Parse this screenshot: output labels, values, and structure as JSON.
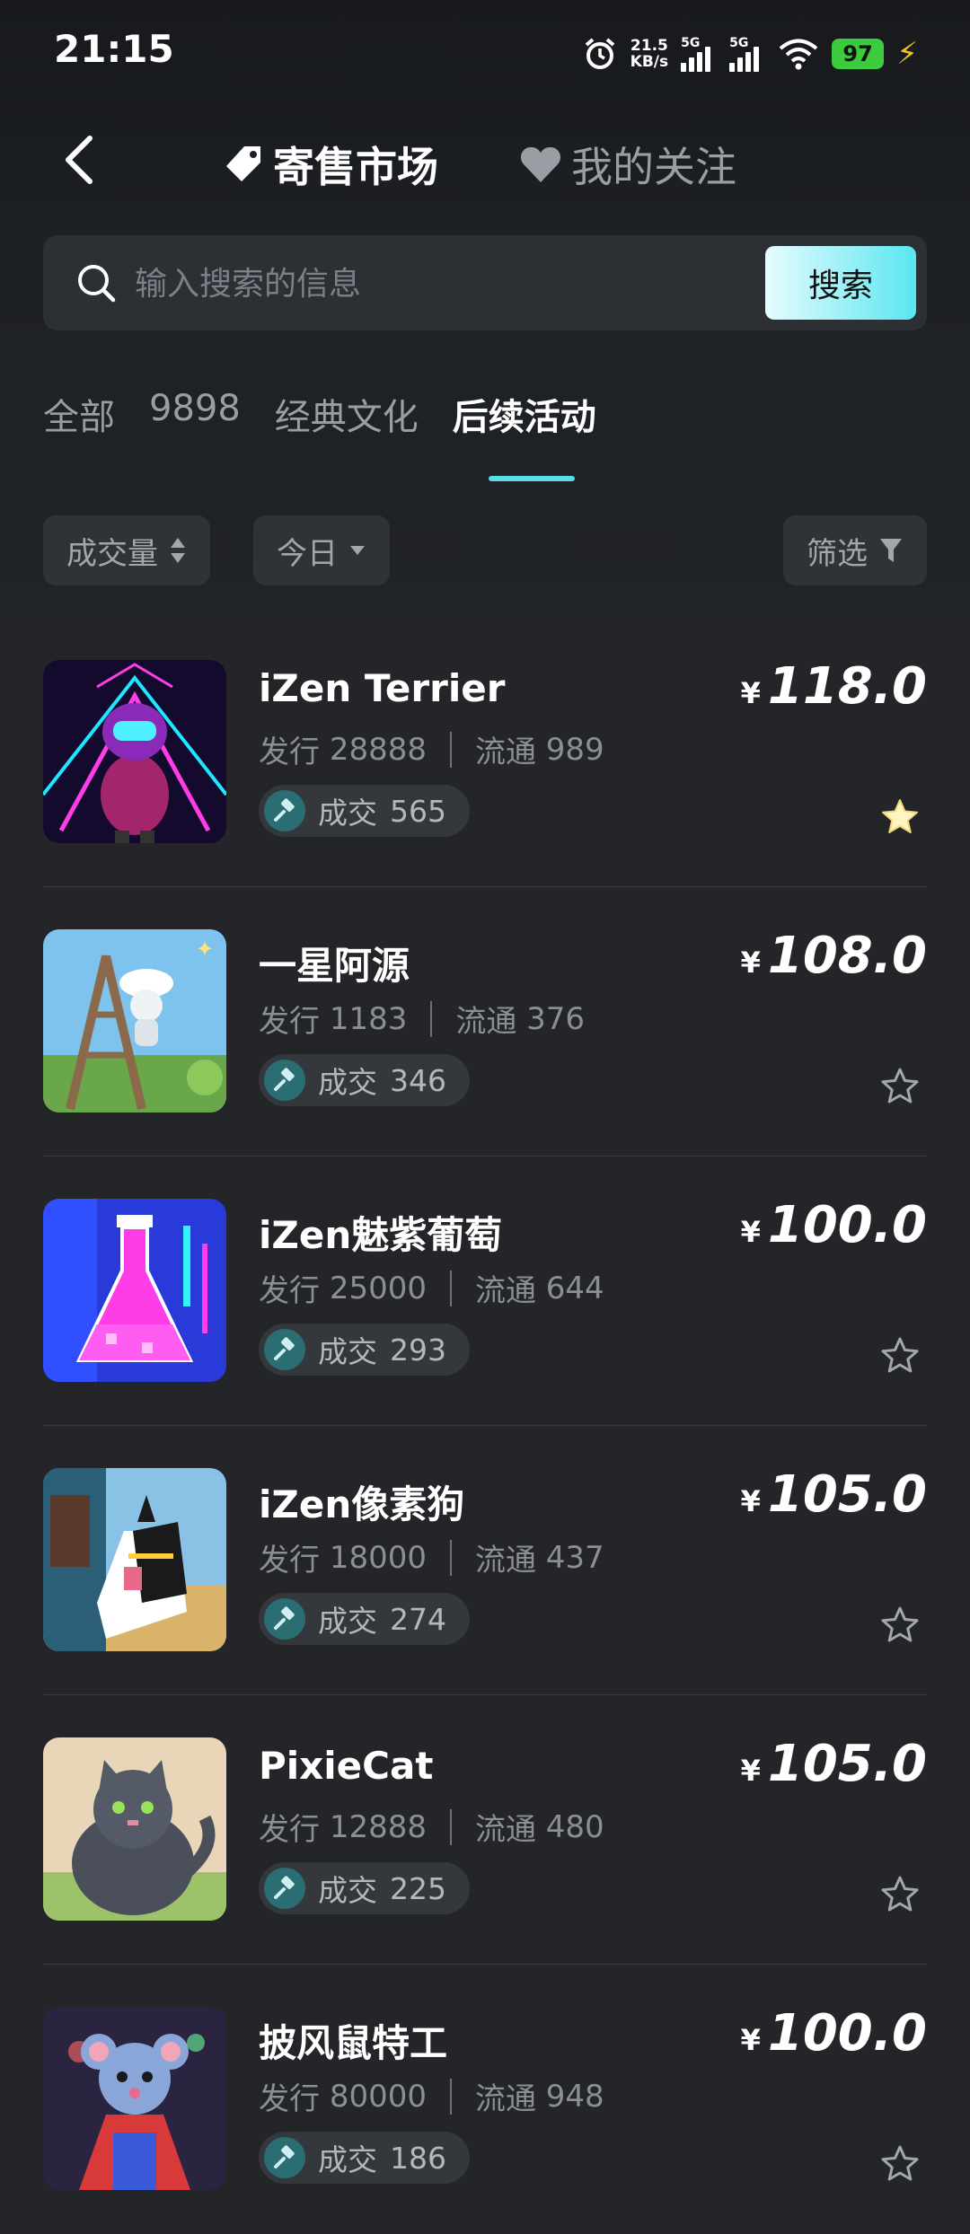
{
  "status": {
    "time": "21:15",
    "speed_value": "21.5",
    "speed_unit": "KB/s",
    "sig1": "5G",
    "sig2": "5G",
    "battery": "97"
  },
  "nav": {
    "market_label": "寄售市场",
    "follow_label": "我的关注"
  },
  "search": {
    "placeholder": "输入搜索的信息",
    "button_label": "搜索"
  },
  "categories": [
    {
      "label": "全部",
      "active": false
    },
    {
      "label": "9898",
      "active": false
    },
    {
      "label": "经典文化",
      "active": false
    },
    {
      "label": "后续活动",
      "active": true
    }
  ],
  "filters": {
    "volume": "成交量",
    "period": "今日",
    "filter": "筛选"
  },
  "labels": {
    "issue": "发行",
    "circulation": "流通",
    "deal": "成交",
    "currency": "¥"
  },
  "items": [
    {
      "name": "iZen Terrier",
      "issue": "28888",
      "circulation": "989",
      "deals": "565",
      "price": "118.0",
      "favorited": true
    },
    {
      "name": "一星阿源",
      "issue": "1183",
      "circulation": "376",
      "deals": "346",
      "price": "108.0",
      "favorited": false
    },
    {
      "name": "iZen魅紫葡萄",
      "issue": "25000",
      "circulation": "644",
      "deals": "293",
      "price": "100.0",
      "favorited": false
    },
    {
      "name": "iZen像素狗",
      "issue": "18000",
      "circulation": "437",
      "deals": "274",
      "price": "105.0",
      "favorited": false
    },
    {
      "name": "PixieCat",
      "issue": "12888",
      "circulation": "480",
      "deals": "225",
      "price": "105.0",
      "favorited": false
    },
    {
      "name": "披风鼠特工",
      "issue": "80000",
      "circulation": "948",
      "deals": "186",
      "price": "100.0",
      "favorited": false
    }
  ]
}
